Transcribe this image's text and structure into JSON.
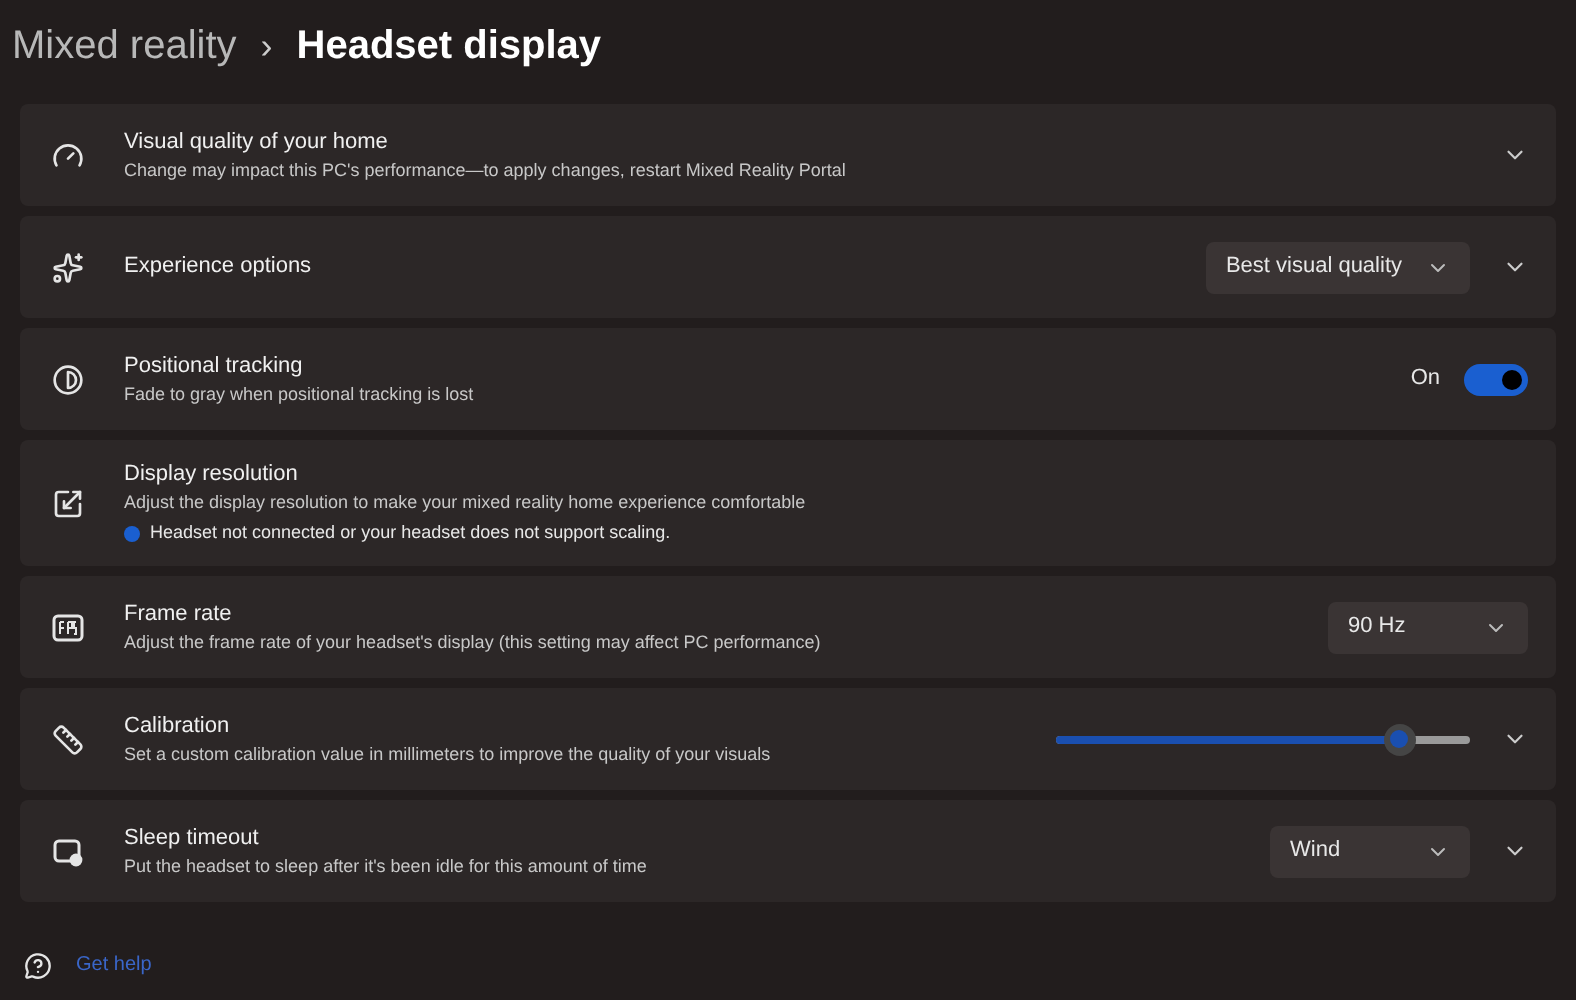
{
  "breadcrumb": [
    {
      "label": "Mixed reality",
      "current": false
    },
    {
      "label": "Headset display",
      "current": true
    }
  ],
  "breadcrumb_separator": "›",
  "rows": [
    {
      "kind": "plain",
      "title": "Visual quality of your home",
      "description": "Change may impact this PC's performance—to apply changes, restart Mixed Reality Portal",
      "expandable": true
    },
    {
      "kind": "dropdown",
      "title": "Experience options",
      "value": "Best visual quality",
      "expandable": true
    },
    {
      "kind": "toggle",
      "title": "Positional tracking",
      "description": "Fade to gray when positional tracking is lost",
      "on": true,
      "state_label": "On",
      "expandable": false
    },
    {
      "kind": "info",
      "title": "Display resolution",
      "description": "Adjust the display resolution to make your mixed reality home experience comfortable",
      "note": "Headset not connected or your headset does not support scaling.",
      "expandable": false
    },
    {
      "kind": "dropdown",
      "title": "Frame rate",
      "description": "Adjust the frame rate of your headset's display (this setting may affect PC performance)",
      "value": "90 Hz",
      "expandable": false
    },
    {
      "kind": "slider",
      "title": "Calibration",
      "description": "Set a custom calibration value in millimeters to improve the quality of your visuals",
      "level": 0.83,
      "expandable": true
    },
    {
      "kind": "dropdown",
      "title": "Sleep timeout",
      "description": "Put the headset to sleep after it's been idle for this amount of time",
      "value": "Wind",
      "expandable": true
    }
  ],
  "help_link": "Get help"
}
